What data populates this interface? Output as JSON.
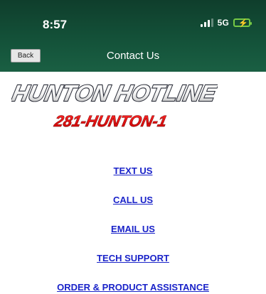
{
  "status_bar": {
    "time": "8:57",
    "network": "5G",
    "icons": [
      "signal-icon",
      "battery-charging-icon"
    ],
    "battery_color": "#76c945"
  },
  "nav": {
    "back_label": "Back",
    "title": "Contact Us"
  },
  "logo": {
    "title": "HUNTON HOTLINE",
    "phone": "281-HUNTON-1",
    "title_color": "#2c2f3a",
    "phone_color": "#e0101a"
  },
  "links": [
    {
      "label": "TEXT US"
    },
    {
      "label": "CALL US"
    },
    {
      "label": "EMAIL US"
    },
    {
      "label": "TECH SUPPORT"
    },
    {
      "label": "ORDER & PRODUCT ASSISTANCE"
    }
  ],
  "colors": {
    "header": "#14533a",
    "link": "#1a23c9"
  }
}
